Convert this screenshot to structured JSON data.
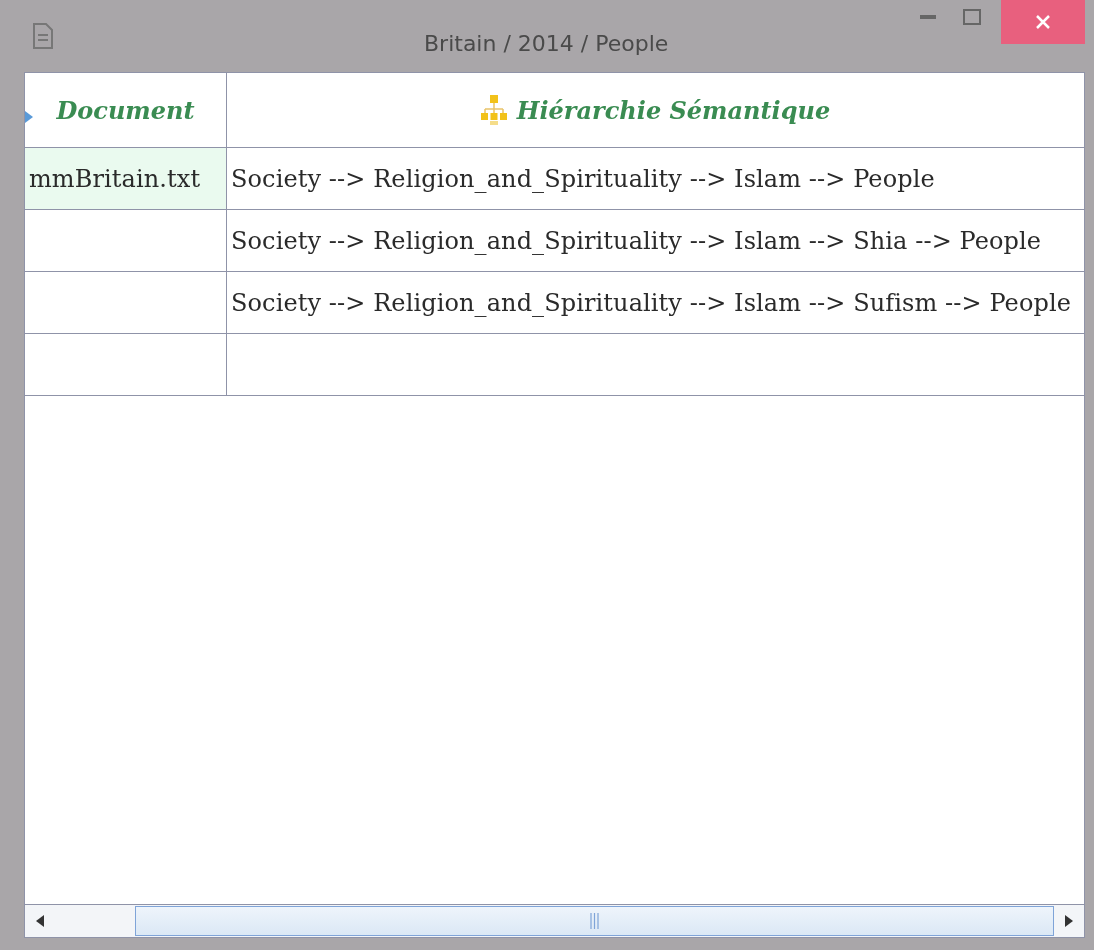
{
  "window": {
    "title": "Britain / 2014 / People"
  },
  "table": {
    "columns": [
      {
        "label": "Document",
        "kind": "plain"
      },
      {
        "label": "Hiérarchie Sémantique",
        "kind": "hierarchy"
      }
    ],
    "rows": [
      {
        "kind": "data",
        "document": "mmBritain.txt",
        "path": "Society --> Religion_and_Spirituality --> Islam --> People",
        "selected": true
      },
      {
        "kind": "data",
        "path": "Society --> Religion_and_Spirituality --> Islam --> Shia --> People",
        "selected": false
      },
      {
        "kind": "data",
        "path": "Society --> Religion_and_Spirituality --> Islam --> Sufism --> People",
        "selected": false
      },
      {
        "kind": "empty",
        "selected": false
      }
    ]
  }
}
